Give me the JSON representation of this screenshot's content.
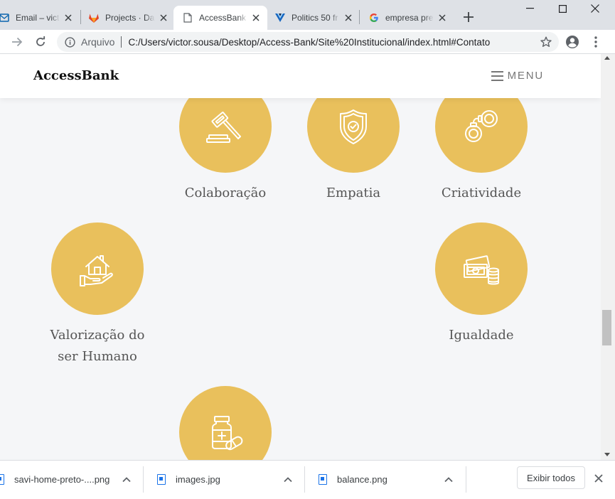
{
  "browser": {
    "tabs": [
      {
        "title": "Email – victo",
        "icon": "outlook-icon",
        "active": false
      },
      {
        "title": "Projects · Da",
        "icon": "gitlab-icon",
        "active": false
      },
      {
        "title": "AccessBank",
        "icon": "document-icon",
        "active": true
      },
      {
        "title": "Politics 50 fr",
        "icon": "vuetify-icon",
        "active": false
      },
      {
        "title": "empresa pre",
        "icon": "google-icon",
        "active": false
      }
    ],
    "new_tab": "+",
    "window_controls": [
      "minimize-icon",
      "maximize-icon",
      "close-icon"
    ],
    "address": {
      "info_label": "Arquivo",
      "url": "C:/Users/victor.sousa/Desktop/Access-Bank/Site%20Institucional/index.html#Contato"
    }
  },
  "site": {
    "brand": "AccessBank",
    "menu_label": "MENU",
    "values": [
      {
        "label": "Colaboração",
        "icon": "gavel-icon"
      },
      {
        "label": "Empatia",
        "icon": "shield-check-icon"
      },
      {
        "label": "Criatividade",
        "icon": "handcuffs-icon"
      },
      {
        "label": "Valorização do\nser Humano",
        "icon": "house-in-hand-icon"
      },
      {
        "label": "Igualdade",
        "icon": "money-coins-icon"
      },
      {
        "label": "",
        "icon": "medicine-pills-icon"
      }
    ],
    "accent_color": "#e9c05c"
  },
  "downloads": {
    "items": [
      {
        "name": "savi-home-preto-....png"
      },
      {
        "name": "images.jpg"
      },
      {
        "name": "balance.png"
      }
    ],
    "show_all_label": "Exibir todos"
  }
}
